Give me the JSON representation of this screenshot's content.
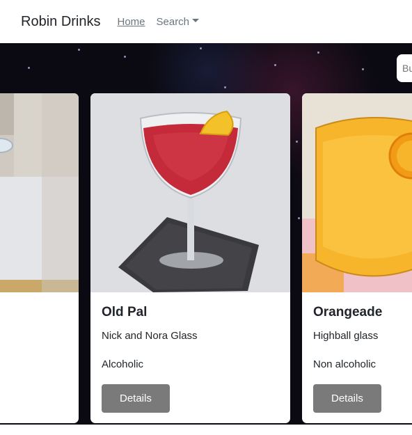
{
  "navbar": {
    "brand": "Robin Drinks",
    "home_label": "Home",
    "search_label": "Search"
  },
  "search": {
    "placeholder": "Bu"
  },
  "cards": [
    {
      "title": "",
      "glass": "",
      "type": "",
      "button_label": ""
    },
    {
      "title": "Old Pal",
      "glass": "Nick and Nora Glass",
      "type": "Alcoholic",
      "button_label": "Details"
    },
    {
      "title": "Orangeade",
      "glass": "Highball glass",
      "type": "Non alcoholic",
      "button_label": "Details"
    }
  ],
  "colors": {
    "button_bg": "#7a7a7a",
    "hero_bg": "#0b0a12"
  }
}
